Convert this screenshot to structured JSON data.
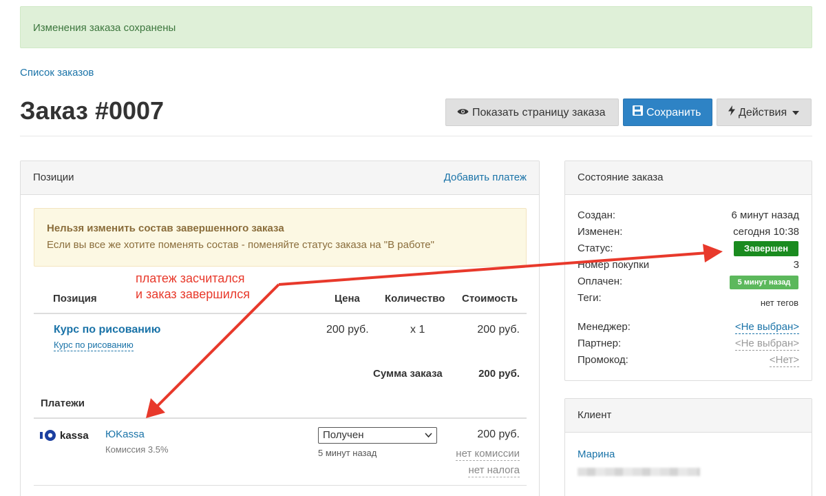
{
  "alert": {
    "text": "Изменения заказа сохранены"
  },
  "breadcrumb": {
    "link": "Список заказов"
  },
  "page": {
    "title": "Заказ #0007"
  },
  "toolbar": {
    "show_label": "Показать страницу заказа",
    "save_label": "Сохранить",
    "actions_label": "Действия",
    "icons": [
      "eye-icon",
      "floppy-icon",
      "bolt-icon",
      "caret-down-icon"
    ]
  },
  "positions": {
    "title": "Позиции",
    "add_payment": "Добавить платеж",
    "warning_title": "Нельзя изменить состав завершенного заказа",
    "warning_text": "Если вы все же хотите поменять состав - поменяйте статус заказа на \"В работе\"",
    "columns": [
      "Позиция",
      "Цена",
      "Количество",
      "Стоимость"
    ],
    "items": [
      {
        "name": "Курс по рисованию",
        "sub": "Курс по рисованию",
        "price": "200 руб.",
        "qty": "x 1",
        "cost": "200 руб."
      }
    ],
    "sum_label": "Сумма заказа",
    "sum_value": "200 руб."
  },
  "payments": {
    "title": "Платежи",
    "items": [
      {
        "logo_text": "kassa",
        "name": "ЮKassa",
        "commission": "Комиссия 3.5%",
        "status": "Получен",
        "time": "5 минут назад",
        "amount": "200 руб.",
        "no_commission": "нет комиссии",
        "no_tax": "нет налога"
      }
    ]
  },
  "annotation": {
    "line1": "платеж засчитался",
    "line2": "и заказ завершился",
    "color": "#e8392b"
  },
  "order_status": {
    "title": "Состояние заказа",
    "created_label": "Создан:",
    "created_value": "6 минут назад",
    "changed_label": "Изменен:",
    "changed_value": "сегодня 10:38",
    "status_label": "Статус:",
    "status_value": "Завершен",
    "purchase_label": "Номер покупки",
    "purchase_value": "3",
    "paid_label": "Оплачен:",
    "paid_value": "5 минут назад",
    "tags_label": "Теги:",
    "tags_value": "нет тегов",
    "manager_label": "Менеджер:",
    "manager_value": "<Не выбран>",
    "partner_label": "Партнер:",
    "partner_value": "<Не выбран>",
    "promo_label": "Промокод:",
    "promo_value": "<Нет>"
  },
  "client": {
    "title": "Клиент",
    "name": "Марина"
  },
  "colors": {
    "link": "#1a73a8",
    "primary": "#2e83c5",
    "success_bg": "#dff0d8",
    "warning_bg": "#fcf8e3",
    "status_done": "#1a8b1f",
    "status_paid": "#5cb85c"
  }
}
